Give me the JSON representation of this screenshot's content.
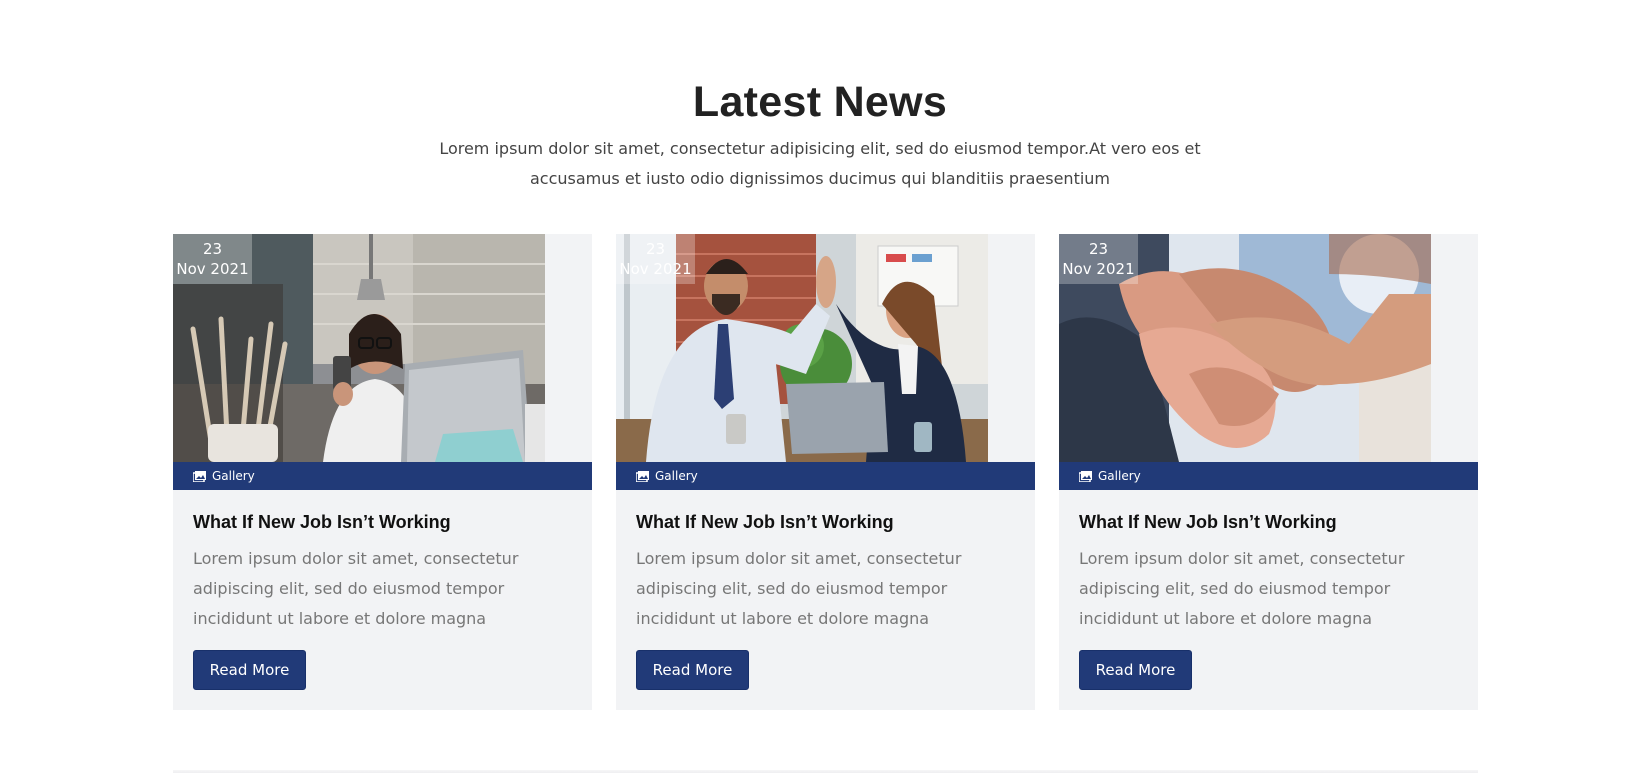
{
  "section": {
    "title": "Latest News",
    "subtitle": "Lorem ipsum dolor sit amet, consectetur adipisicing elit, sed do eiusmod tempor.At vero eos et accusamus et iusto odio dignissimos ducimus qui blanditiis praesentium"
  },
  "colors": {
    "accent": "#213a78",
    "card_bg": "#f2f3f5"
  },
  "posts": [
    {
      "date_day": "23",
      "date_month_year": "Nov 2021",
      "category": "Gallery",
      "category_icon": "gallery-icon",
      "title": "What If New Job Isn’t Working",
      "excerpt": "Lorem ipsum dolor sit amet, consectetur adipiscing elit, sed do eiusmod tempor incididunt ut labore et dolore magna",
      "button_label": "Read More"
    },
    {
      "date_day": "23",
      "date_month_year": "Nov 2021",
      "category": "Gallery",
      "category_icon": "gallery-icon",
      "title": "What If New Job Isn’t Working",
      "excerpt": "Lorem ipsum dolor sit amet, consectetur adipiscing elit, sed do eiusmod tempor incididunt ut labore et dolore magna",
      "button_label": "Read More"
    },
    {
      "date_day": "23",
      "date_month_year": "Nov 2021",
      "category": "Gallery",
      "category_icon": "gallery-icon",
      "title": "What If New Job Isn’t Working",
      "excerpt": "Lorem ipsum dolor sit amet, consectetur adipiscing elit, sed do eiusmod tempor incididunt ut labore et dolore magna",
      "button_label": "Read More"
    }
  ]
}
